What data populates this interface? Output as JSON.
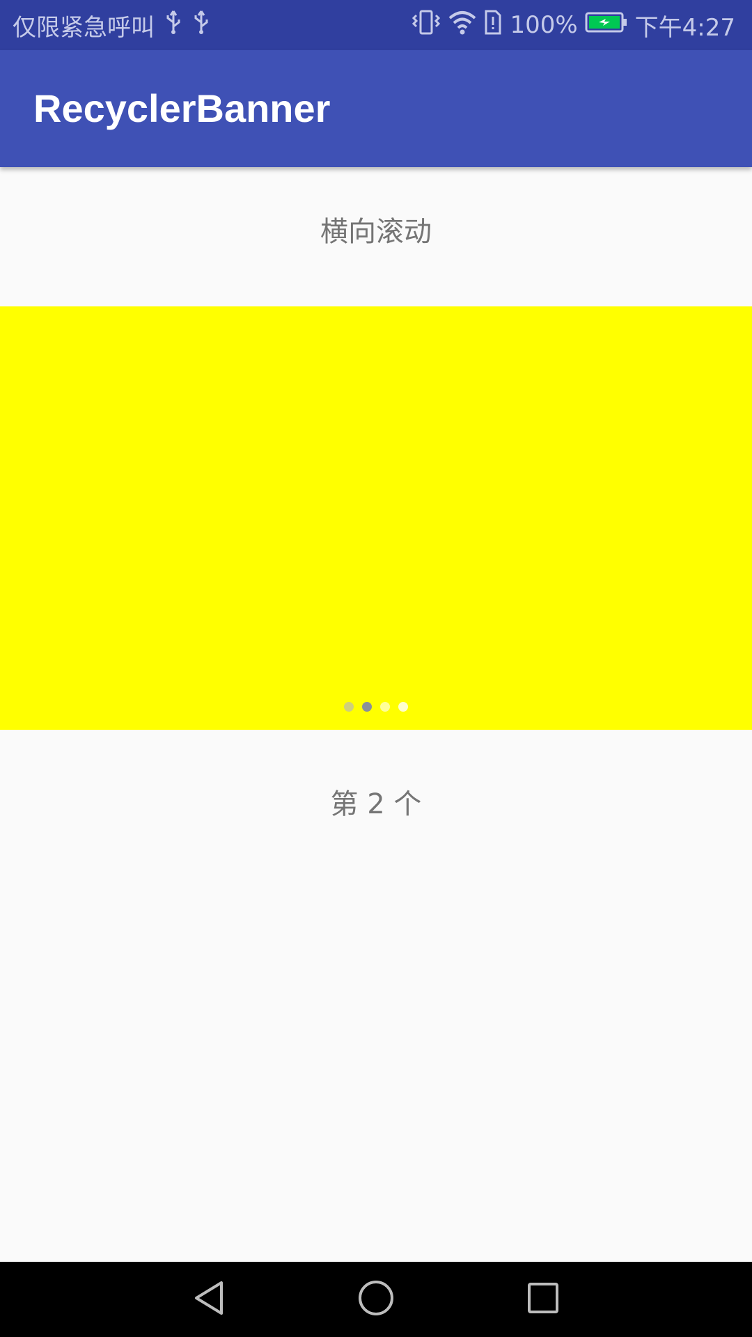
{
  "status_bar": {
    "carrier_text": "仅限紧急呼叫",
    "usb_icons": [
      "usb-icon",
      "usb-icon"
    ],
    "battery_percent": "100%",
    "time": "下午4:27",
    "battery_color": "#00c853"
  },
  "toolbar": {
    "title": "RecyclerBanner"
  },
  "main": {
    "section_title": "横向滚动",
    "banner": {
      "color": "#ffff00",
      "indicator_count": 4,
      "active_index": 1
    },
    "counter_text": "第 2 个"
  },
  "nav_bar": {
    "buttons": [
      "back",
      "home",
      "recents"
    ]
  }
}
